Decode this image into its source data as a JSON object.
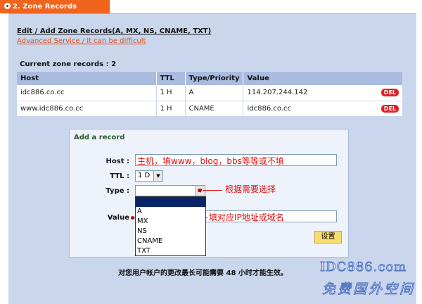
{
  "tab": {
    "label": "2. Zone Records"
  },
  "header": {
    "title": "Edit / Add Zone Records(A, MX, NS, CNAME, TXT)",
    "advanced_link": "Advanced Service / It can be difficult"
  },
  "records": {
    "count_label": "Current zone records : 2",
    "columns": [
      "Host",
      "TTL",
      "Type/Priority",
      "Value"
    ],
    "rows": [
      {
        "host": "idc886.co.cc",
        "ttl": "1 H",
        "type": "A",
        "value": "114.207.244.142",
        "action": "DEL"
      },
      {
        "host": "www.idc886.co.cc",
        "ttl": "1 H",
        "type": "CNAME",
        "value": "idc886.co.cc",
        "action": "DEL"
      }
    ]
  },
  "add_form": {
    "title": "Add a record",
    "host_label": "Host :",
    "host_value": "主机，填www，blog，bbs等等或不填",
    "ttl_label": "TTL :",
    "ttl_value": "1 D",
    "type_label": "Type :",
    "type_value": "",
    "type_hint": "根据需要选择",
    "type_options": [
      "",
      "A",
      "MX",
      "NS",
      "CNAME",
      "TXT"
    ],
    "value_label": "Value",
    "value_hint": "填对应IP地址或域名",
    "save_label": "设置"
  },
  "note": "对您用户帐户的更改最长可能需要 48 小时才能生效。",
  "watermark": {
    "line1": "IDC886.com",
    "line2": "免费国外空间"
  },
  "colors": {
    "tab": "#f0641e",
    "panel": "#c9d6ec",
    "header_row": "#a9bbdf",
    "del": "#dd2222",
    "annotation": "#e01010",
    "save": "#f6dc6e"
  }
}
